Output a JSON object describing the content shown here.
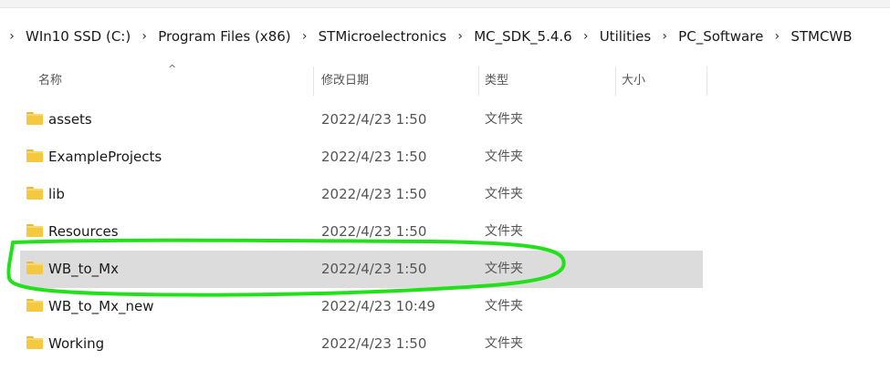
{
  "breadcrumb": {
    "segments": [
      "WIn10 SSD (C:)",
      "Program Files (x86)",
      "STMicroelectronics",
      "MC_SDK_5.4.6",
      "Utilities",
      "PC_Software",
      "STMCWB"
    ]
  },
  "columns": {
    "name": "名称",
    "date": "修改日期",
    "type": "类型",
    "size": "大小"
  },
  "files": [
    {
      "name": "assets",
      "date": "2022/4/23 1:50",
      "type": "文件夹",
      "icon": "folder-icon"
    },
    {
      "name": "ExampleProjects",
      "date": "2022/4/23 1:50",
      "type": "文件夹",
      "icon": "folder-icon"
    },
    {
      "name": "lib",
      "date": "2022/4/23 1:50",
      "type": "文件夹",
      "icon": "folder-icon"
    },
    {
      "name": "Resources",
      "date": "2022/4/23 1:50",
      "type": "文件夹",
      "icon": "folder-icon"
    },
    {
      "name": "WB_to_Mx",
      "date": "2022/4/23 1:50",
      "type": "文件夹",
      "icon": "folder-icon",
      "selected": true
    },
    {
      "name": "WB_to_Mx_new",
      "date": "2022/4/23 10:49",
      "type": "文件夹",
      "icon": "folder-icon"
    },
    {
      "name": "Working",
      "date": "2022/4/23 1:50",
      "type": "文件夹",
      "icon": "folder-icon"
    }
  ],
  "colors": {
    "selection": "#dcdcdc",
    "annotation": "#22e01a",
    "folder": "#f5c93f"
  }
}
